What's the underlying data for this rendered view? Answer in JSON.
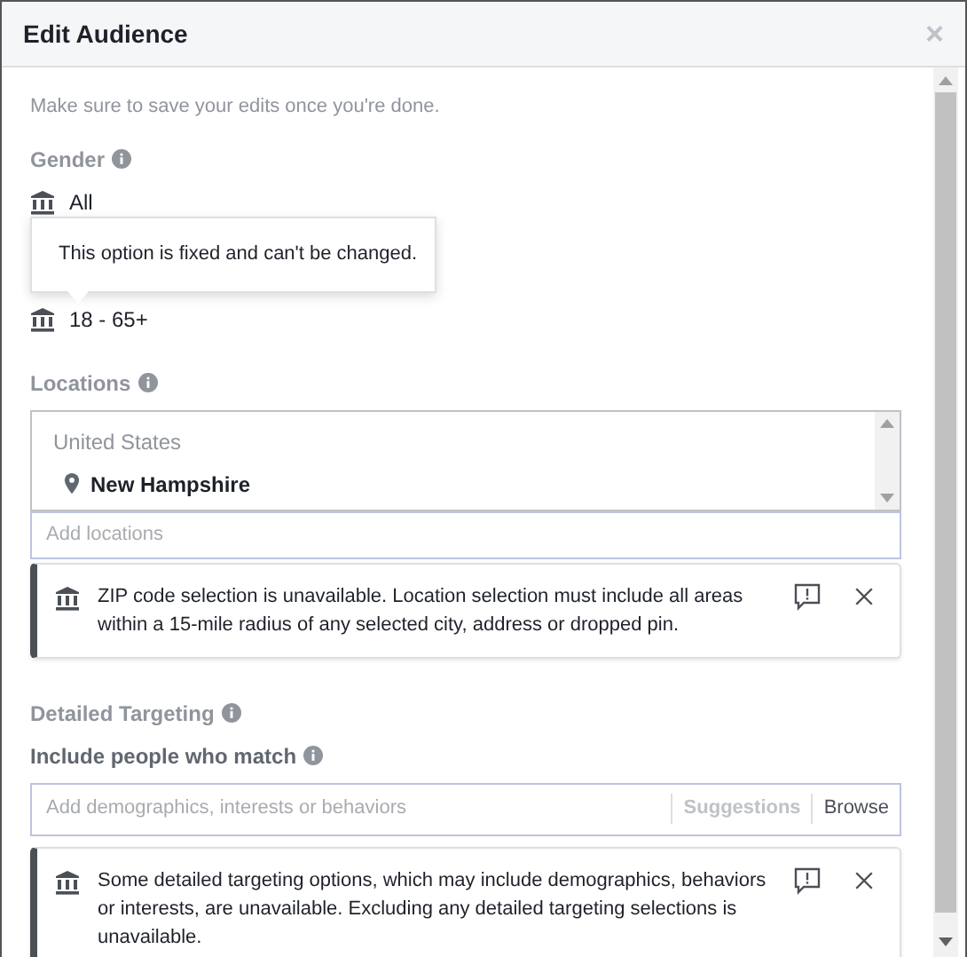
{
  "window": {
    "title": "Edit Audience",
    "close": "×"
  },
  "intro": "Make sure to save your edits once you're done.",
  "gender": {
    "label": "Gender",
    "value": "All"
  },
  "tooltip": "This option is fixed and can't be changed.",
  "age": {
    "value": "18 - 65+"
  },
  "locations": {
    "label": "Locations",
    "country": "United States",
    "items": [
      "New Hampshire"
    ],
    "placeholder": "Add locations",
    "notice": "ZIP code selection is unavailable. Location selection must include all areas within a 15-mile radius of any selected city, address or dropped pin."
  },
  "detailed_targeting": {
    "label": "Detailed Targeting",
    "include_label": "Include people who match",
    "placeholder": "Add demographics, interests or behaviors",
    "suggestions": "Suggestions",
    "browse": "Browse",
    "notice": "Some detailed targeting options, which may include demographics, behaviors or interests, are unavailable. Excluding any detailed targeting selections is unavailable."
  }
}
